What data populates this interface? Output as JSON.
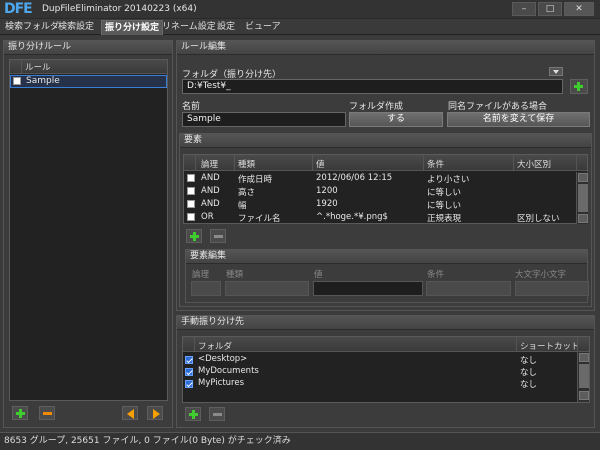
{
  "app": {
    "logo": "DFE",
    "title": "DupFileEliminator 20140223 (x64)",
    "min": "–",
    "max": "□",
    "close": "✕"
  },
  "tabs": [
    "検索フォルダ",
    "検索設定",
    "振り分け設定",
    "リネーム設定",
    "設定",
    "ビューア"
  ],
  "left": {
    "title": "振り分けルール",
    "column": "ルール",
    "items": [
      {
        "label": "Sample",
        "checked": false
      }
    ]
  },
  "rule_edit": {
    "title": "ルール編集",
    "folder_label": "フォルダ（振り分け先）",
    "folder_value": "D:¥Test¥_",
    "name_label": "名前",
    "name_value": "Sample",
    "create_label": "フォルダ作成",
    "create_value": "する",
    "dup_label": "同名ファイルがある場合",
    "dup_value": "名前を変えて保存"
  },
  "elements": {
    "title": "要素",
    "columns": [
      "論理",
      "種類",
      "値",
      "条件",
      "大小区別"
    ],
    "rows": [
      {
        "logic": "AND",
        "kind": "作成日時",
        "value": "2012/06/06 12:15",
        "cond": "より小さい",
        "case": ""
      },
      {
        "logic": "AND",
        "kind": "高さ",
        "value": "1200",
        "cond": "に等しい",
        "case": ""
      },
      {
        "logic": "AND",
        "kind": "幅",
        "value": "1920",
        "cond": "に等しい",
        "case": ""
      },
      {
        "logic": "OR",
        "kind": "ファイル名",
        "value": "^.*hoge.*¥.png$",
        "cond": "正規表現",
        "case": "区別しない"
      }
    ]
  },
  "element_edit": {
    "title": "要素編集",
    "labels": [
      "論理",
      "種類",
      "値",
      "条件",
      "大文字小文字"
    ]
  },
  "manual": {
    "title": "手動振り分け先",
    "columns": [
      "フォルダ",
      "ショートカット"
    ],
    "rows": [
      {
        "folder": "<Desktop>",
        "shortcut": "なし"
      },
      {
        "folder": "MyDocuments",
        "shortcut": "なし"
      },
      {
        "folder": "MyPictures",
        "shortcut": "なし"
      }
    ]
  },
  "status": "8653 グループ, 25651 ファイル, 0 ファイル(0 Byte) がチェック済み",
  "colors": {
    "accent_add": "#3fcc2e",
    "accent_remove": "#f08a00",
    "logo": "#4ea7ec",
    "selection": "#2d6fd6"
  }
}
